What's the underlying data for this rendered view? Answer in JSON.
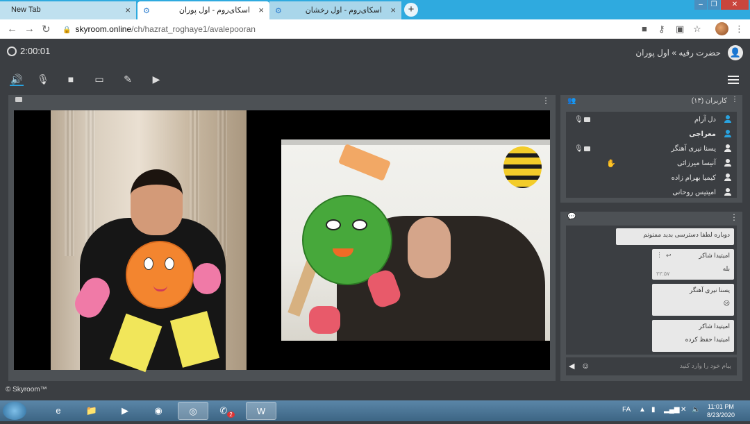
{
  "browser": {
    "tabs": [
      {
        "title": "New Tab"
      },
      {
        "title": "اسکای‌روم - اول پوران"
      },
      {
        "title": "اسکای‌روم - اول رخشان"
      }
    ],
    "url_host": "skyroom.online",
    "url_path": "/ch/hazrat_roghaye1/avalepooran"
  },
  "header": {
    "timer": "2:00:01",
    "room_title": "حضرت رقیه » اول پوران"
  },
  "users": {
    "title": "کاربران (۱۴)",
    "list": [
      {
        "name": "دل آرام",
        "bold": false,
        "mic": true,
        "cam": true,
        "hand": false
      },
      {
        "name": "معراجی",
        "bold": true,
        "mic": false,
        "cam": false,
        "hand": false
      },
      {
        "name": "یسنا نیری آهنگر",
        "bold": false,
        "mic": true,
        "cam": true,
        "hand": false
      },
      {
        "name": "آنیسا میرزائی",
        "bold": false,
        "mic": false,
        "cam": false,
        "hand": true
      },
      {
        "name": "کیمیا بهرام زاده",
        "bold": false,
        "mic": false,
        "cam": false,
        "hand": false
      },
      {
        "name": "امیتیس روحانی",
        "bold": false,
        "mic": false,
        "cam": false,
        "hand": false
      }
    ]
  },
  "chat": {
    "messages": [
      {
        "sender": "",
        "text": "دوباره لطفا دسترسی بدید ممنونم",
        "time": ""
      },
      {
        "sender": "امیتیدا شاکر",
        "text": "بله",
        "time": "۲۲:۵۷"
      },
      {
        "sender": "یسنا نیری آهنگر",
        "text": "☹",
        "time": ""
      },
      {
        "sender": "امیتیدا شاکر",
        "text": "امیتیدا حفظ کرده",
        "time": ""
      }
    ],
    "placeholder": "پیام خود را وارد کنید"
  },
  "footer": {
    "copyright": "© Skyroom™"
  },
  "taskbar": {
    "lang": "FA",
    "time": "11:01 PM",
    "date": "8/23/2020",
    "badge": "2"
  },
  "colors": {
    "accent": "#29a3e0",
    "tabbar": "#2faadf",
    "panel": "#4d5155"
  }
}
